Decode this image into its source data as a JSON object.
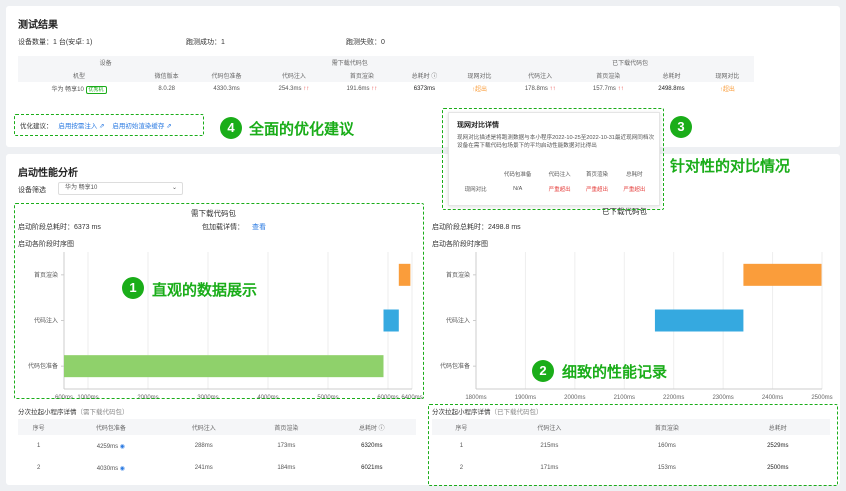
{
  "test_result": {
    "title": "测试结果",
    "device_count": "设备数量：1 台(安卓: 1)",
    "run_success": "跑测成功：1",
    "run_fail": "跑测失败：0",
    "group_device": "设备",
    "group_demand": "需下载代码包",
    "group_downloaded": "已下载代码包",
    "headers": [
      "机型",
      "微信版本",
      "代码包准备",
      "代码注入",
      "首页渲染",
      "总耗时",
      "现网对比",
      "代码注入",
      "首页渲染",
      "总耗时",
      "现网对比"
    ],
    "row": {
      "model": "华为 畅享10",
      "tag": "优秀机",
      "wechat": "8.0.28",
      "prep": "4330.3ms",
      "inject": "254.3ms",
      "inject_arrows": "↑↑",
      "render": "191.6ms",
      "render_arrows": "↑↑",
      "total": "6373ms",
      "compare": "↑超出",
      "inject2": "178.8ms",
      "inject2_arrows": "↑↑",
      "render2": "157.7ms",
      "render2_arrows": "↑↑",
      "total2": "2498.8ms",
      "compare2": "↑超出"
    },
    "advice_label": "优化建议：",
    "advice_links": [
      "启用按需注入",
      "启用初始渲染缓存"
    ]
  },
  "popup": {
    "title": "现网对比详情",
    "desc": "现网对比描述是将跑测数据与本小程序2022-10-25至2022-10-31最近现网同档次设备在需下载代码包场景下的平均启动性能数据对比得出",
    "headers": [
      "",
      "代码包准备",
      "代码注入",
      "首页渲染",
      "总耗时"
    ],
    "row_label": "现网对比",
    "values": [
      "N/A",
      "严重超出",
      "严重超出",
      "严重超出"
    ]
  },
  "startup": {
    "title": "启动性能分析",
    "device_filter_label": "设备筛选",
    "device_filter_value": "华为 畅享10",
    "left": {
      "title": "需下载代码包",
      "total": "启动阶段总耗时：6373 ms",
      "pkg_detail": "包加载详情：",
      "pkg_view": "查看",
      "chart_title": "启动各阶段时序图"
    },
    "right": {
      "title": "已下载代码包",
      "total": "启动阶段总耗时：2498.8 ms",
      "chart_title": "启动各阶段时序图"
    }
  },
  "chart_data": [
    {
      "type": "bar",
      "title": "启动各阶段时序图",
      "categories": [
        "首页渲染",
        "代码注入",
        "代码包准备"
      ],
      "ranges": [
        [
          6180,
          6373
        ],
        [
          5925,
          6180
        ],
        [
          600,
          5925
        ]
      ],
      "xlim": [
        600,
        6400
      ],
      "xticks": [
        "600ms",
        "1000ms",
        "2000ms",
        "3000ms",
        "4000ms",
        "5000ms",
        "6000ms",
        "6400ms"
      ],
      "colors": [
        "#fa9d3b",
        "#35a9e0",
        "#8fd16b"
      ]
    },
    {
      "type": "bar",
      "title": "启动各阶段时序图",
      "categories": [
        "首页渲染",
        "代码注入",
        "代码包准备"
      ],
      "ranges": [
        [
          2341,
          2499
        ],
        [
          2162,
          2341
        ],
        [
          null,
          null
        ]
      ],
      "xlim": [
        1800,
        2500
      ],
      "xticks": [
        "1800ms",
        "1900ms",
        "2000ms",
        "2100ms",
        "2200ms",
        "2300ms",
        "2400ms",
        "2500ms"
      ],
      "colors": [
        "#fa9d3b",
        "#35a9e0",
        "#8fd16b"
      ]
    }
  ],
  "detail_left": {
    "title": "分次拉起小程序详情",
    "subtitle": "（需下载代码包）",
    "headers": [
      "序号",
      "代码包准备",
      "代码注入",
      "首页渲染",
      "总耗时"
    ],
    "rows": [
      [
        "1",
        "4259ms",
        "288ms",
        "173ms",
        "6320ms"
      ],
      [
        "2",
        "4030ms",
        "241ms",
        "184ms",
        "6021ms"
      ]
    ]
  },
  "detail_right": {
    "title": "分次拉起小程序详情",
    "subtitle": "（已下载代码包）",
    "headers": [
      "序号",
      "代码注入",
      "首页渲染",
      "总耗时"
    ],
    "rows": [
      [
        "1",
        "215ms",
        "160ms",
        "2529ms"
      ],
      [
        "2",
        "171ms",
        "153ms",
        "2500ms"
      ]
    ]
  },
  "callouts": {
    "c1": {
      "num": "1",
      "text": "直观的数据展示"
    },
    "c2": {
      "num": "2",
      "text": "细致的性能记录"
    },
    "c3": {
      "num": "3",
      "text": "针对性的对比情况"
    },
    "c4": {
      "num": "4",
      "text": "全面的优化建议"
    }
  },
  "colors": {
    "accent": "#1aad19",
    "red": "#e64340",
    "blue": "#2a7ae2"
  }
}
